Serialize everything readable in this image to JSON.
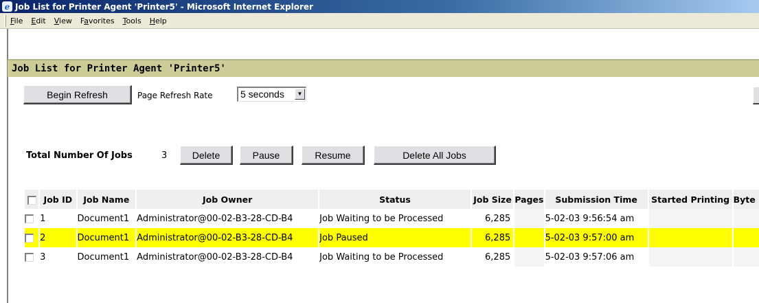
{
  "window": {
    "title": "Job List for Printer Agent 'Printer5' - Microsoft Internet Explorer",
    "icon": "ie-icon"
  },
  "menu": [
    {
      "label": "File",
      "u": "F"
    },
    {
      "label": "Edit",
      "u": "E"
    },
    {
      "label": "View",
      "u": "V"
    },
    {
      "label": "Favorites",
      "u": "a"
    },
    {
      "label": "Tools",
      "u": "T"
    },
    {
      "label": "Help",
      "u": "H"
    }
  ],
  "page": {
    "title": "Job List for Printer Agent 'Printer5'",
    "refresh_button": "Begin Refresh",
    "refresh_rate_label": "Page Refresh Rate",
    "refresh_rate_value": "5 seconds",
    "total_jobs_label": "Total Number Of Jobs",
    "total_jobs_value": "3",
    "buttons": {
      "delete": "Delete",
      "pause": "Pause",
      "resume": "Resume",
      "delete_all": "Delete All Jobs"
    }
  },
  "table": {
    "headers": [
      "Job ID",
      "Job Name",
      "Job Owner",
      "Status",
      "Job Size",
      "Pages",
      "Submission Time",
      "Started Printing",
      "Byte"
    ],
    "rows": [
      {
        "id": "1",
        "name": "Document1",
        "owner": "Administrator@00-02-B3-28-CD-B4",
        "status": "Job Waiting to be Processed",
        "size": "6,285",
        "pages": "",
        "submitted": "5-02-03 9:56:54 am",
        "started": "",
        "bytes": "",
        "highlight": false
      },
      {
        "id": "2",
        "name": "Document1",
        "owner": "Administrator@00-02-B3-28-CD-B4",
        "status": "Job Paused",
        "size": "6,285",
        "pages": "",
        "submitted": "5-02-03 9:57:00 am",
        "started": "",
        "bytes": "",
        "highlight": true
      },
      {
        "id": "3",
        "name": "Document1",
        "owner": "Administrator@00-02-B3-28-CD-B4",
        "status": "Job Waiting to be Processed",
        "size": "6,285",
        "pages": "",
        "submitted": "5-02-03 9:57:06 am",
        "started": "",
        "bytes": "",
        "highlight": false
      }
    ]
  },
  "colors": {
    "title_band": "#cccc99",
    "highlight_row": "#ffff00",
    "header_bg": "#eeeeee"
  }
}
